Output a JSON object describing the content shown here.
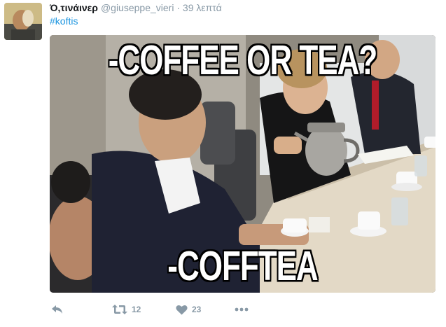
{
  "tweet": {
    "author_name": "Ό,τινάινερ",
    "author_handle": "@giuseppe_vieri",
    "separator": "·",
    "time": "39 λεπτά",
    "hashtag": "#koftis",
    "media": {
      "top_caption": "-COFFEE OR TEA?",
      "bottom_caption": "-COFFTEA"
    },
    "actions": {
      "retweet_count": "12",
      "like_count": "23"
    }
  },
  "icons": {
    "reply": "reply-icon",
    "retweet": "retweet-icon",
    "like": "heart-icon",
    "more": "more-dots-icon"
  },
  "colors": {
    "hashtag": "#1b95e0",
    "muted": "#8899a6"
  }
}
